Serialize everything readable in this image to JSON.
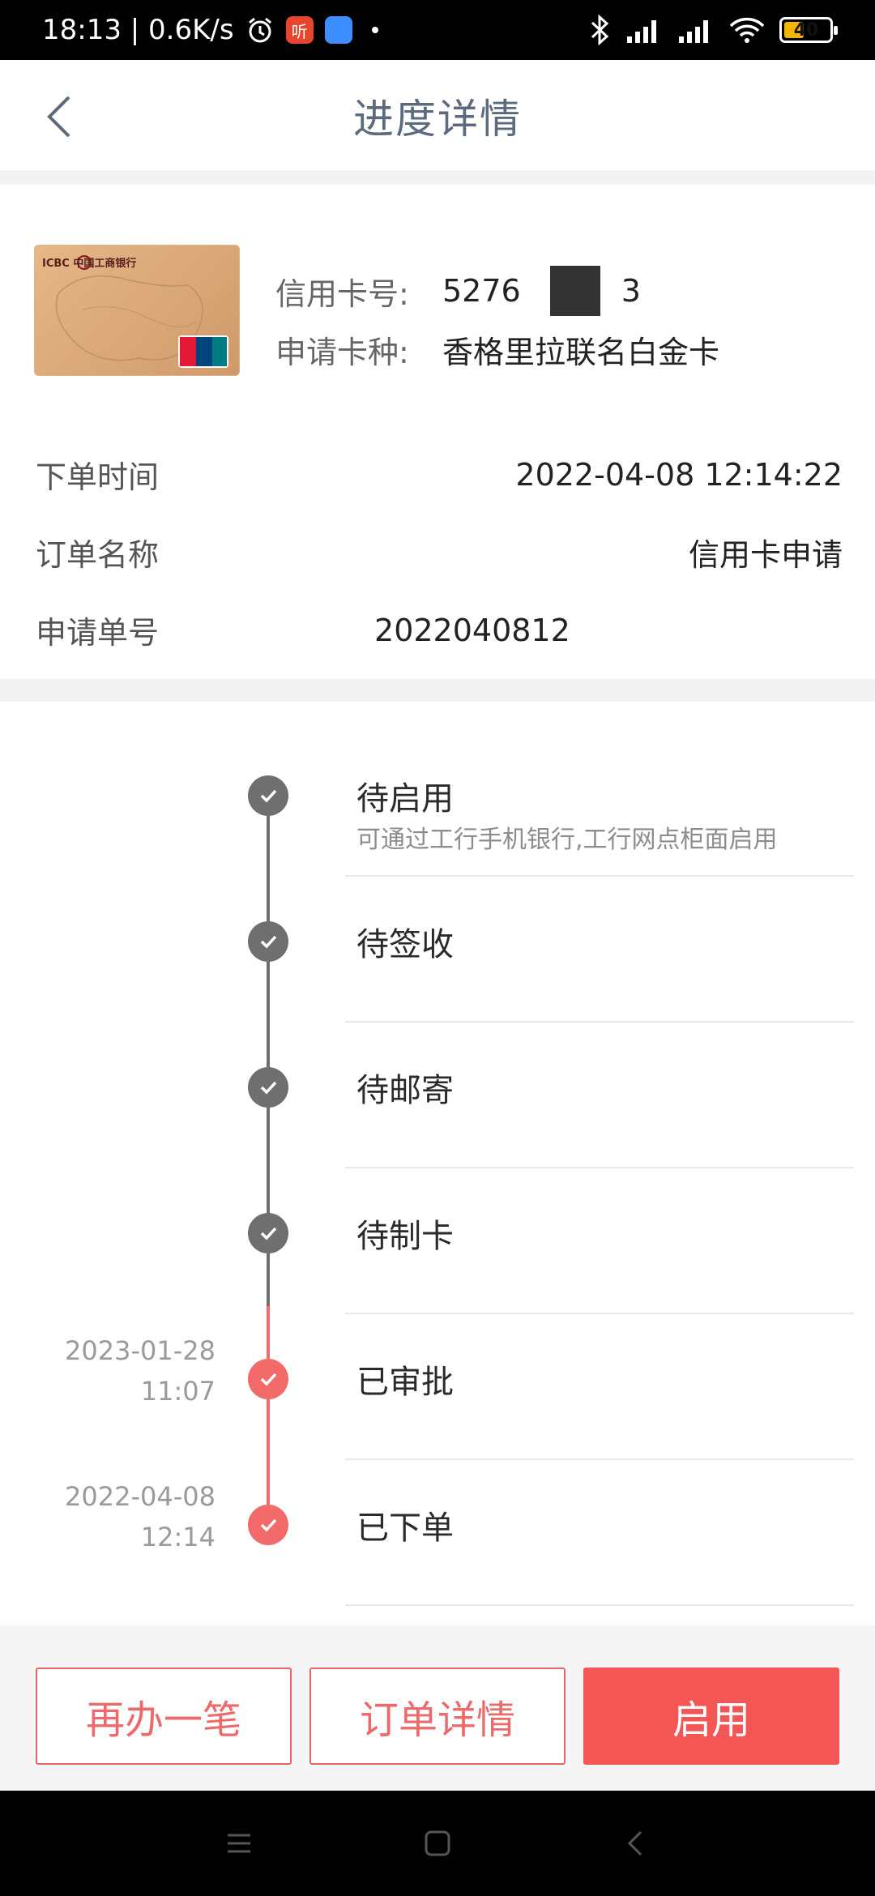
{
  "status_bar": {
    "time_speed": "18:13 | 0.6K/s",
    "red_app_label": "听",
    "battery_level": "40"
  },
  "header": {
    "title": "进度详情"
  },
  "card_info": {
    "card_no_label": "信用卡号:",
    "card_no_prefix": "5276",
    "card_no_masked_tail": "3",
    "card_type_label": "申请卡种:",
    "card_type_value": "香格里拉联名白金卡",
    "card_bank_text": "ICBC 中国工商银行"
  },
  "order_meta": {
    "time_label": "下单时间",
    "time_value": "2022-04-08 12:14:22",
    "name_label": "订单名称",
    "name_value": "信用卡申请",
    "no_label": "申请单号",
    "no_value": "2022040812"
  },
  "timeline": {
    "steps": [
      {
        "title": "待启用",
        "subtitle": "可通过工行手机银行,工行网点柜面启用",
        "date": "",
        "time": "",
        "status": "pending"
      },
      {
        "title": "待签收",
        "subtitle": "",
        "date": "",
        "time": "",
        "status": "pending"
      },
      {
        "title": "待邮寄",
        "subtitle": "",
        "date": "",
        "time": "",
        "status": "pending"
      },
      {
        "title": "待制卡",
        "subtitle": "",
        "date": "",
        "time": "",
        "status": "pending"
      },
      {
        "title": "已审批",
        "subtitle": "",
        "date": "2023-01-28",
        "time": "11:07",
        "status": "done"
      },
      {
        "title": "已下单",
        "subtitle": "",
        "date": "2022-04-08",
        "time": "12:14",
        "status": "done"
      }
    ]
  },
  "actions": {
    "again_label": "再办一笔",
    "detail_label": "订单详情",
    "activate_label": "启用"
  },
  "colors": {
    "accent_red": "#f45555",
    "timeline_gray": "#6f6f6f",
    "timeline_red": "#f36a6a",
    "title_blue_gray": "#5b6b7d"
  }
}
